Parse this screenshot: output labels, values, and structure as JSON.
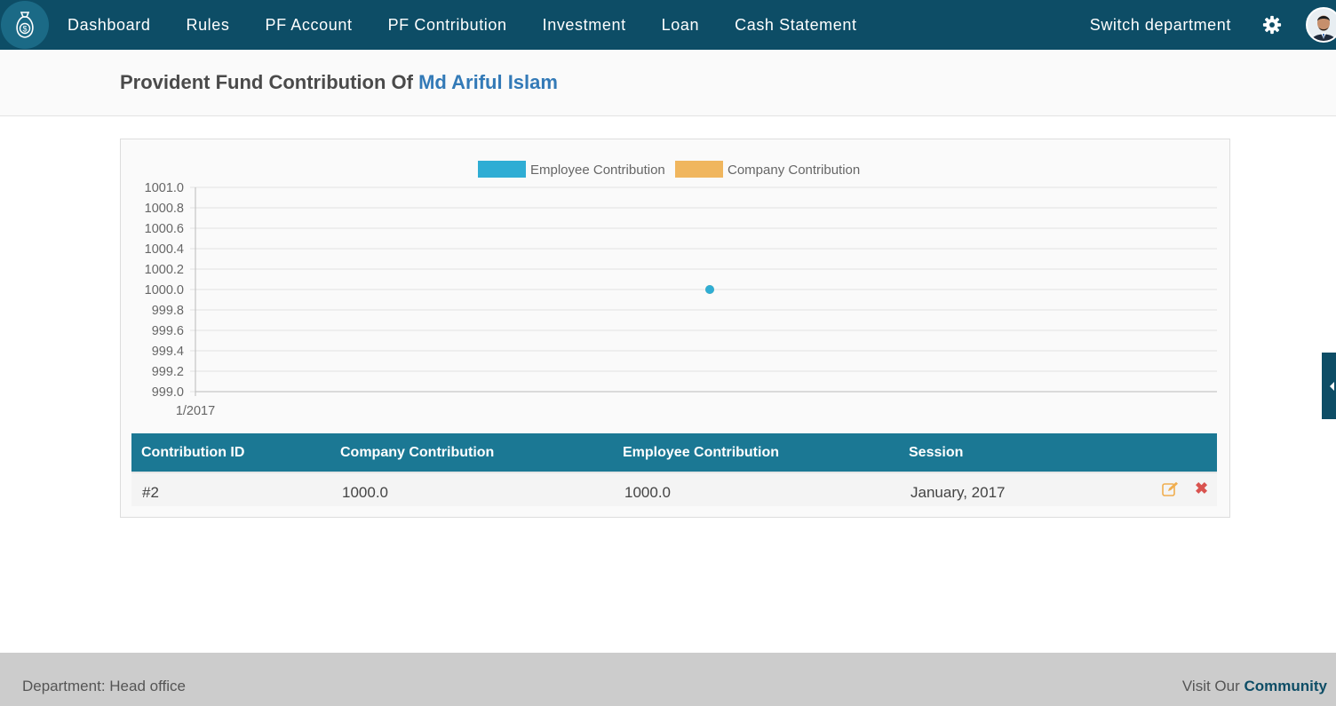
{
  "nav": {
    "logo_icon": "money-bag-icon",
    "items": [
      {
        "label": "Dashboard"
      },
      {
        "label": "Rules"
      },
      {
        "label": "PF Account"
      },
      {
        "label": "PF Contribution"
      },
      {
        "label": "Investment"
      },
      {
        "label": "Loan"
      },
      {
        "label": "Cash Statement"
      }
    ],
    "switch_department": "Switch department",
    "settings_icon": "gear-icon",
    "avatar_icon": "user-avatar"
  },
  "header": {
    "title_prefix": "Provident Fund Contribution Of",
    "employee_name": "Md Ariful Islam"
  },
  "colors": {
    "nav_bg": "#0d4d66",
    "table_header": "#1b7894",
    "employee_series": "#2fadd4",
    "company_series": "#f0b65e",
    "link": "#337ab7",
    "delete": "#d9534f",
    "edit": "#f0ad4e"
  },
  "chart_data": {
    "type": "line",
    "x": [
      "1/2017"
    ],
    "series": [
      {
        "name": "Employee Contribution",
        "values": [
          1000.0
        ],
        "color": "#2fadd4"
      },
      {
        "name": "Company Contribution",
        "values": [
          1000.0
        ],
        "color": "#f0b65e"
      }
    ],
    "ylim": [
      999.0,
      1001.0
    ],
    "yticks": [
      "1001.0",
      "1000.8",
      "1000.6",
      "1000.4",
      "1000.2",
      "1000.0",
      "999.8",
      "999.6",
      "999.4",
      "999.2",
      "999.0"
    ],
    "legend_position": "top-center",
    "grid": true
  },
  "table": {
    "headers": [
      "Contribution ID",
      "Company Contribution",
      "Employee Contribution",
      "Session"
    ],
    "rows": [
      {
        "id": "#2",
        "company": "1000.0",
        "employee": "1000.0",
        "session": "January, 2017"
      }
    ],
    "edit_icon": "edit-icon",
    "delete_icon": "delete-icon"
  },
  "footer": {
    "department_label": "Department: Head office",
    "visit_prefix": "Visit Our",
    "community_link": "Community"
  }
}
